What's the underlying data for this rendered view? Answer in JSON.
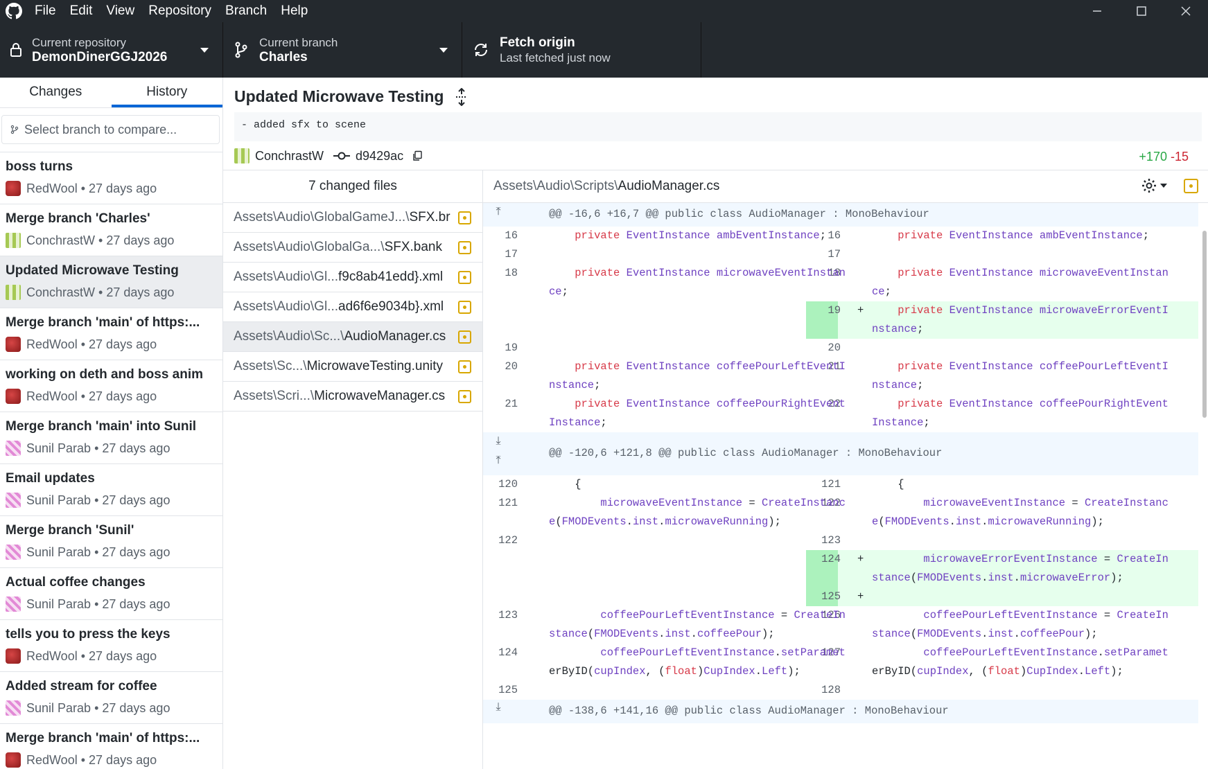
{
  "menu": [
    "File",
    "Edit",
    "View",
    "Repository",
    "Branch",
    "Help"
  ],
  "toolbar": {
    "repo_label": "Current repository",
    "repo_value": "DemonDinerGGJ2026",
    "branch_label": "Current branch",
    "branch_value": "Charles",
    "fetch_label": "Fetch origin",
    "fetch_sub": "Last fetched just now"
  },
  "sidebar": {
    "tabs": [
      "Changes",
      "History"
    ],
    "compare_placeholder": "Select branch to compare...",
    "commits": [
      {
        "title": "boss turns",
        "author": "RedWool",
        "when": "27 days ago",
        "avatar": "red"
      },
      {
        "title": "Merge branch 'Charles'",
        "author": "ConchrastW",
        "when": "27 days ago",
        "avatar": "green"
      },
      {
        "title": "Updated Microwave Testing",
        "author": "ConchrastW",
        "when": "27 days ago",
        "avatar": "green"
      },
      {
        "title": "Merge branch 'main' of https:...",
        "author": "RedWool",
        "when": "27 days ago",
        "avatar": "red"
      },
      {
        "title": "working on deth and boss anim",
        "author": "RedWool",
        "when": "27 days ago",
        "avatar": "red"
      },
      {
        "title": "Merge branch 'main' into Sunil",
        "author": "Sunil Parab",
        "when": "27 days ago",
        "avatar": "pink"
      },
      {
        "title": "Email updates",
        "author": "Sunil Parab",
        "when": "27 days ago",
        "avatar": "pink"
      },
      {
        "title": "Merge branch 'Sunil'",
        "author": "Sunil Parab",
        "when": "27 days ago",
        "avatar": "pink"
      },
      {
        "title": "Actual coffee changes",
        "author": "Sunil Parab",
        "when": "27 days ago",
        "avatar": "pink"
      },
      {
        "title": "tells you to press the keys",
        "author": "RedWool",
        "when": "27 days ago",
        "avatar": "red"
      },
      {
        "title": "Added stream for coffee",
        "author": "Sunil Parab",
        "when": "27 days ago",
        "avatar": "pink"
      },
      {
        "title": "Merge branch 'main' of https:...",
        "author": "RedWool",
        "when": "27 days ago",
        "avatar": "red"
      }
    ]
  },
  "commit": {
    "title": "Updated Microwave Testing",
    "description": "- added sfx to scene",
    "author": "ConchrastW",
    "sha": "d9429ac",
    "additions": "+170",
    "deletions": "-15"
  },
  "files": {
    "header": "7 changed files",
    "items": [
      {
        "pre": "Assets\\Audio\\GlobalGameJ...\\",
        "name": "SFX.br"
      },
      {
        "pre": "Assets\\Audio\\GlobalGa...\\",
        "name": "SFX.bank"
      },
      {
        "pre": "Assets\\Audio\\Gl...",
        "name": "f9c8ab41edd}.xml"
      },
      {
        "pre": "Assets\\Audio\\Gl...",
        "name": "ad6f6e9034b}.xml"
      },
      {
        "pre": "Assets\\Audio\\Sc...\\",
        "name": "AudioManager.cs"
      },
      {
        "pre": "Assets\\Sc...\\",
        "name": "MicrowaveTesting.unity"
      },
      {
        "pre": "Assets\\Scri...\\",
        "name": "MicrowaveManager.cs"
      }
    ]
  },
  "diff": {
    "path_dir": "Assets\\Audio\\Scripts\\",
    "path_file": "AudioManager.cs",
    "hunks": [
      "@@ -16,6 +16,7 @@ public class AudioManager : MonoBehaviour",
      "@@ -120,6 +121,8 @@ public class AudioManager : MonoBehaviour",
      "@@ -138,6 +141,16 @@ public class AudioManager : MonoBehaviour"
    ],
    "lines": [
      {
        "l": "16",
        "r": "16",
        "lc": "    private EventInstance ambEventInstance;",
        "rc": "    private EventInstance ambEventInstance;"
      },
      {
        "l": "17",
        "r": "17",
        "lc": "",
        "rc": ""
      },
      {
        "l": "18",
        "r": "18",
        "lc": "    private EventInstance microwaveEventInstan\nce;",
        "rc": "    private EventInstance microwaveEventInstan\nce;"
      },
      {
        "l": "",
        "r": "19",
        "lc": "",
        "rc": "    private EventInstance microwaveErrorEventI\nnstance;",
        "add": true
      },
      {
        "l": "19",
        "r": "20",
        "lc": "",
        "rc": ""
      },
      {
        "l": "20",
        "r": "21",
        "lc": "    private EventInstance coffeePourLeftEventI\nnstance;",
        "rc": "    private EventInstance coffeePourLeftEventI\nnstance;"
      },
      {
        "l": "21",
        "r": "22",
        "lc": "    private EventInstance coffeePourRightEvent\nInstance;",
        "rc": "    private EventInstance coffeePourRightEvent\nInstance;"
      },
      {
        "l": "120",
        "r": "121",
        "lc": "    {",
        "rc": "    {"
      },
      {
        "l": "121",
        "r": "122",
        "lc": "        microwaveEventInstance = CreateInstanc\ne(FMODEvents.inst.microwaveRunning);",
        "rc": "        microwaveEventInstance = CreateInstanc\ne(FMODEvents.inst.microwaveRunning);"
      },
      {
        "l": "122",
        "r": "123",
        "lc": "",
        "rc": ""
      },
      {
        "l": "",
        "r": "124",
        "lc": "",
        "rc": "        microwaveErrorEventInstance = CreateIn\nstance(FMODEvents.inst.microwaveError);",
        "add": true
      },
      {
        "l": "",
        "r": "125",
        "lc": "",
        "rc": "",
        "add": true
      },
      {
        "l": "123",
        "r": "126",
        "lc": "        coffeePourLeftEventInstance = CreateIn\nstance(FMODEvents.inst.coffeePour);",
        "rc": "        coffeePourLeftEventInstance = CreateIn\nstance(FMODEvents.inst.coffeePour);"
      },
      {
        "l": "124",
        "r": "127",
        "lc": "        coffeePourLeftEventInstance.setParamet\nerByID(cupIndex, (float)CupIndex.Left);",
        "rc": "        coffeePourLeftEventInstance.setParamet\nerByID(cupIndex, (float)CupIndex.Left);"
      },
      {
        "l": "125",
        "r": "128",
        "lc": "",
        "rc": ""
      }
    ]
  },
  "colors": {
    "accent": "#0366d6",
    "addition": "#28a745",
    "deletion": "#cb2431",
    "titlebar": "#24292e"
  }
}
